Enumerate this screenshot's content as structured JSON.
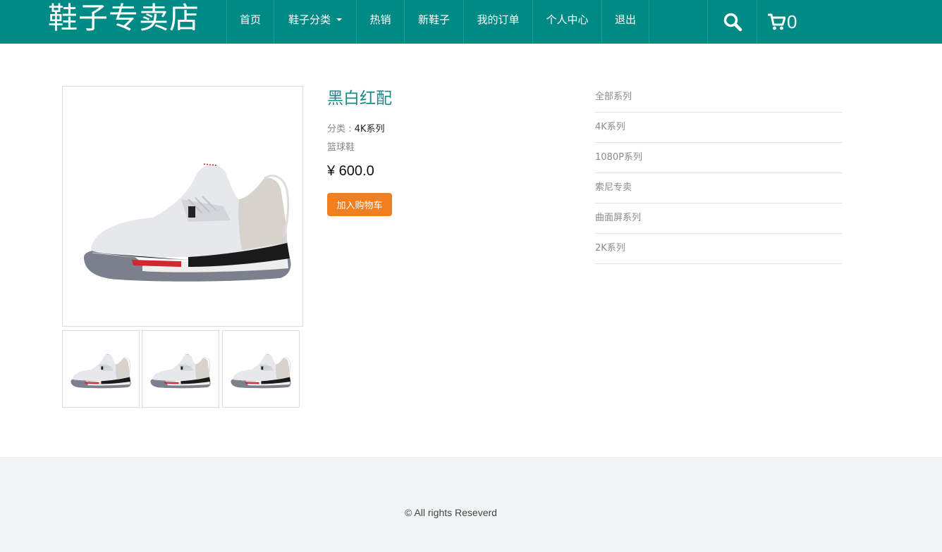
{
  "header": {
    "brand": "鞋子专卖店",
    "nav": [
      {
        "label": "首页"
      },
      {
        "label": "鞋子分类"
      },
      {
        "label": "热销"
      },
      {
        "label": "新鞋子"
      },
      {
        "label": "我的订单"
      },
      {
        "label": "个人中心"
      },
      {
        "label": "退出"
      }
    ],
    "search_icon": "search-icon",
    "cart_icon": "cart-icon",
    "cart_count": "0",
    "bar_color": "#008a85"
  },
  "product": {
    "title": "黑白红配",
    "category_label": "分类 : ",
    "category_value": "4K系列",
    "type": "篮球鞋",
    "price": "¥ 600.0",
    "add_to_cart": "加入购物车",
    "title_color": "#1b8a86",
    "button_color": "#f0801f"
  },
  "sidebar": {
    "items": [
      {
        "label": "全部系列"
      },
      {
        "label": "4K系列"
      },
      {
        "label": "1080P系列"
      },
      {
        "label": "索尼专卖"
      },
      {
        "label": "曲面屏系列"
      },
      {
        "label": "2K系列"
      }
    ]
  },
  "footer": {
    "copyright": "© All rights Reseverd"
  }
}
